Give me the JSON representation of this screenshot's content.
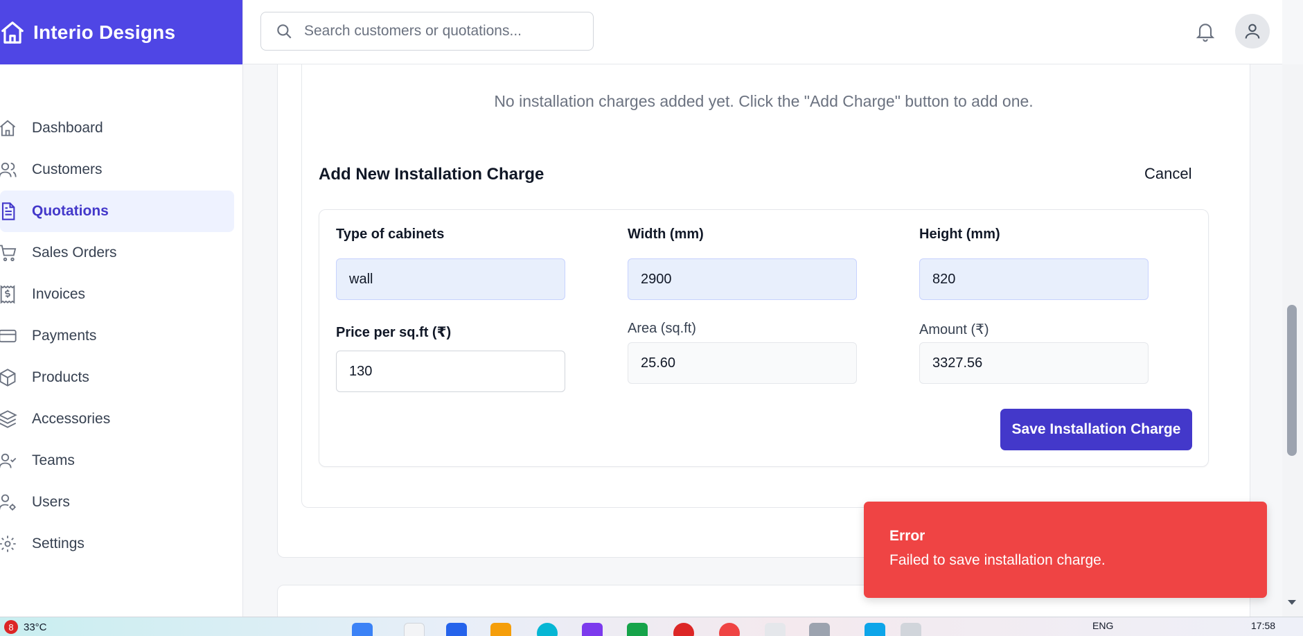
{
  "brand": {
    "name": "Interio Designs"
  },
  "search": {
    "placeholder": "Search customers or quotations..."
  },
  "sidebar": {
    "items": [
      {
        "label": "Dashboard",
        "icon": "home-icon",
        "active": false
      },
      {
        "label": "Customers",
        "icon": "users-icon",
        "active": false
      },
      {
        "label": "Quotations",
        "icon": "document-icon",
        "active": true
      },
      {
        "label": "Sales Orders",
        "icon": "cart-icon",
        "active": false
      },
      {
        "label": "Invoices",
        "icon": "receipt-icon",
        "active": false
      },
      {
        "label": "Payments",
        "icon": "credit-card-icon",
        "active": false
      },
      {
        "label": "Products",
        "icon": "box-icon",
        "active": false
      },
      {
        "label": "Accessories",
        "icon": "layers-icon",
        "active": false
      },
      {
        "label": "Teams",
        "icon": "user-check-icon",
        "active": false
      },
      {
        "label": "Users",
        "icon": "user-cog-icon",
        "active": false
      },
      {
        "label": "Settings",
        "icon": "gear-icon",
        "active": false
      }
    ]
  },
  "main": {
    "empty_message": "No installation charges added yet. Click the \"Add Charge\" button to add one.",
    "section_title": "Add New Installation Charge",
    "cancel_label": "Cancel",
    "form": {
      "type_label": "Type of cabinets",
      "type_value": "wall",
      "width_label": "Width (mm)",
      "width_value": "2900",
      "height_label": "Height (mm)",
      "height_value": "820",
      "price_label": "Price per sq.ft (₹)",
      "price_value": "130",
      "area_label": "Area (sq.ft)",
      "area_value": "25.60",
      "amount_label": "Amount (₹)",
      "amount_value": "3327.56"
    },
    "save_label": "Save Installation Charge"
  },
  "toast": {
    "title": "Error",
    "message": "Failed to save installation charge."
  },
  "taskbar": {
    "weather_badge": "8",
    "temperature": "33°C",
    "language": "ENG",
    "time": "17:58"
  },
  "colors": {
    "brand": "#4f46e5",
    "primary_button": "#4338ca",
    "active_nav_bg": "#eef2ff",
    "error_toast": "#ef4444",
    "filled_input": "#e8effc"
  }
}
